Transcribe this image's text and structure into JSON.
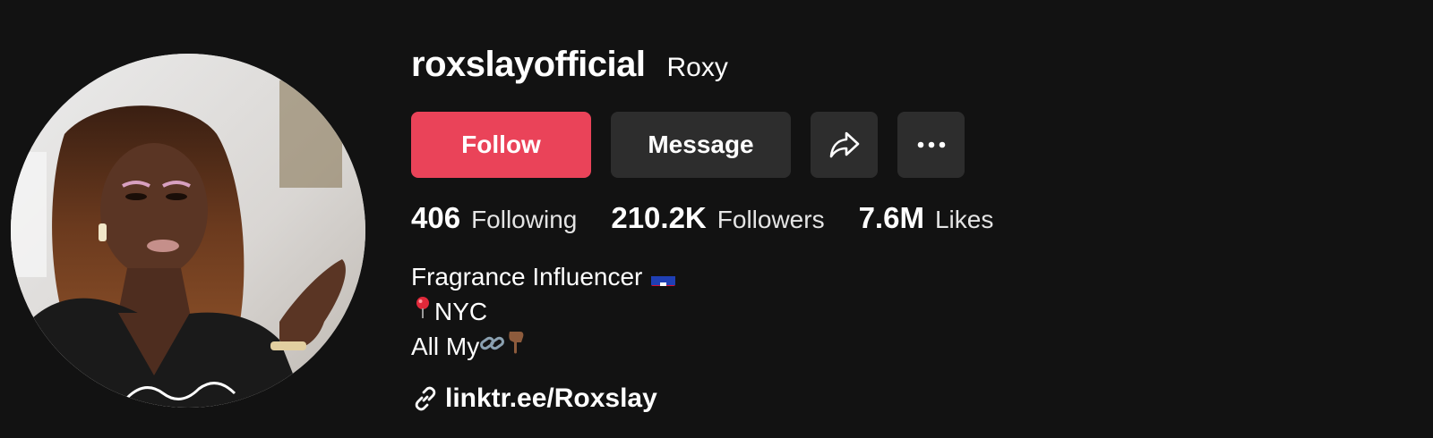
{
  "profile": {
    "username": "roxslayofficial",
    "nickname": "Roxy",
    "avatar_icon": "avatar-photo"
  },
  "actions": {
    "follow_label": "Follow",
    "message_label": "Message",
    "share_icon": "share-arrow-icon",
    "more_icon": "more-dots-icon"
  },
  "stats": {
    "following": {
      "value": "406",
      "label": "Following"
    },
    "followers": {
      "value": "210.2K",
      "label": "Followers"
    },
    "likes": {
      "value": "7.6M",
      "label": "Likes"
    }
  },
  "bio": {
    "line1": "Fragrance Influencer",
    "line1_emoji": "haiti-flag",
    "line2": "NYC",
    "line2_emoji": "round-pushpin",
    "line3": "All My",
    "line3_emojis": [
      "link",
      "backhand-index-pointing-down"
    ]
  },
  "link": {
    "text": "linktr.ee/Roxslay",
    "icon": "link-icon"
  },
  "colors": {
    "background": "#121212",
    "follow_button": "#ea4359",
    "secondary_button": "#2d2d2d",
    "text": "#ffffff"
  }
}
